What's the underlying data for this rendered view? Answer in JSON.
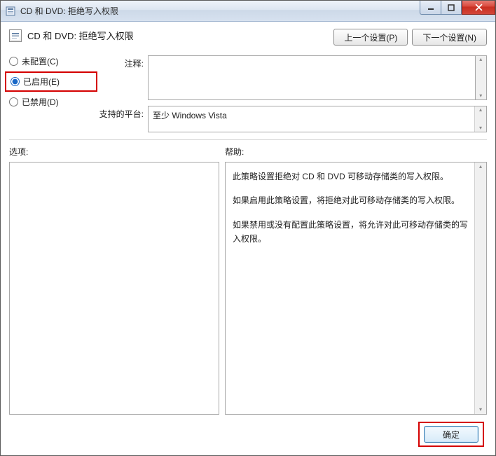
{
  "window": {
    "title": "CD 和 DVD: 拒绝写入权限"
  },
  "header": {
    "title": "CD 和 DVD: 拒绝写入权限"
  },
  "nav": {
    "prev_label": "上一个设置(P)",
    "next_label": "下一个设置(N)"
  },
  "radios": {
    "not_configured": "未配置(C)",
    "enabled": "已启用(E)",
    "disabled": "已禁用(D)",
    "selected": "enabled"
  },
  "fields": {
    "notes_label": "注释:",
    "notes_value": "",
    "platform_label": "支持的平台:",
    "platform_value": "至少 Windows Vista"
  },
  "sections": {
    "options_label": "选项:",
    "help_label": "帮助:"
  },
  "help": {
    "p1": "此策略设置拒绝对 CD 和 DVD 可移动存储类的写入权限。",
    "p2": "如果启用此策略设置，将拒绝对此可移动存储类的写入权限。",
    "p3": "如果禁用或没有配置此策略设置，将允许对此可移动存储类的写入权限。"
  },
  "footer": {
    "ok_label": "确定"
  },
  "icons": {
    "app": "▣",
    "header": "▤"
  }
}
